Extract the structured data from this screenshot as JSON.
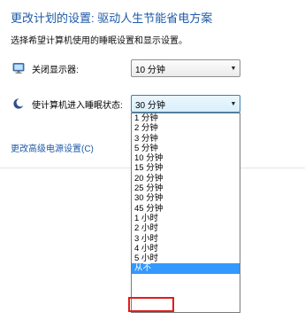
{
  "header": {
    "title": "更改计划的设置: 驱动人生节能省电方案",
    "subtitle": "选择希望计算机使用的睡眠设置和显示设置。"
  },
  "display_setting": {
    "icon": "monitor-icon",
    "label": "关闭显示器:",
    "value": "10 分钟"
  },
  "sleep_setting": {
    "icon": "moon-icon",
    "label": "使计算机进入睡眠状态:",
    "value": "30 分钟",
    "options": [
      "1 分钟",
      "2 分钟",
      "3 分钟",
      "5 分钟",
      "10 分钟",
      "15 分钟",
      "20 分钟",
      "25 分钟",
      "30 分钟",
      "45 分钟",
      "1 小时",
      "2 小时",
      "3 小时",
      "4 小时",
      "5 小时",
      "从不"
    ],
    "highlighted_option": "从不"
  },
  "advanced_link": "更改高级电源设置(C)",
  "colors": {
    "link": "#1e5aa8",
    "selection": "#3399ff",
    "annotation": "#e21b1b"
  }
}
